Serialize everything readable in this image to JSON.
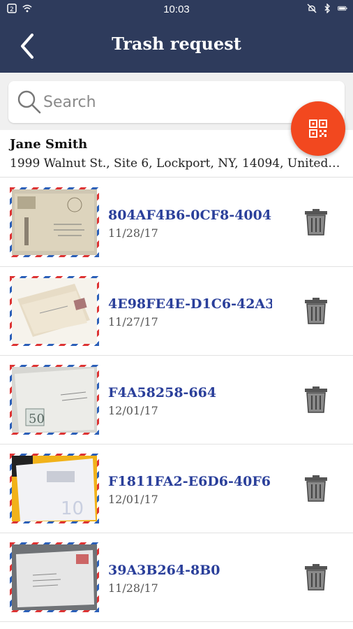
{
  "status_bar": {
    "time": "10:03"
  },
  "header": {
    "title": "Trash request"
  },
  "search": {
    "placeholder": "Search",
    "value": ""
  },
  "user": {
    "name": "Jane Smith",
    "address": "1999 Walnut St., Site 6, Lockport, NY, 14094, United…"
  },
  "items": [
    {
      "id": "804AF4B6-0CF8-4004",
      "date": "11/28/17",
      "thumb_bg": "#cfc7b3",
      "thumb_accent": "#b2a88e"
    },
    {
      "id": "4E98FE4E-D1C6-42A3",
      "date": "11/27/17",
      "thumb_bg": "#efe9dc",
      "thumb_accent": "#c9b896"
    },
    {
      "id": "F4A58258-664",
      "date": "12/01/17",
      "thumb_bg": "#dcdcd8",
      "thumb_accent": "#9aa6a0"
    },
    {
      "id": "F1811FA2-E6D6-40F6",
      "date": "12/01/17",
      "thumb_bg": "#e9e9ee",
      "thumb_accent": "#f1b21a"
    },
    {
      "id": "39A3B264-8B0",
      "date": "11/28/17",
      "thumb_bg": "#8a8c8f",
      "thumb_accent": "#e6e6e6"
    }
  ],
  "colors": {
    "header": "#2e3b5c",
    "accent": "#f2481f",
    "id_text": "#2a3f9a"
  }
}
